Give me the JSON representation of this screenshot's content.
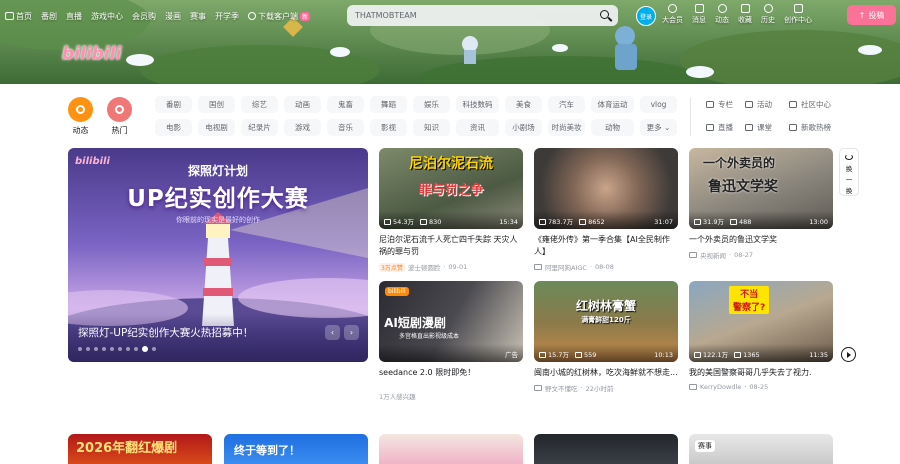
{
  "topnav": {
    "left": [
      "首页",
      "番剧",
      "直播",
      "游戏中心",
      "会员购",
      "漫画",
      "赛事",
      "开学季"
    ],
    "download": "下载客户端",
    "new_badge": "新"
  },
  "search": {
    "value": "THATMOBTEAM"
  },
  "login": "登录",
  "rightnav": [
    "大会员",
    "消息",
    "动态",
    "收藏",
    "历史",
    "创作中心"
  ],
  "upload": "投稿",
  "logo": "bilibili",
  "channels": {
    "big": [
      {
        "label": "动态",
        "color": "#ff9212"
      },
      {
        "label": "热门",
        "color": "#f07775"
      }
    ],
    "row1": [
      "番剧",
      "国创",
      "综艺",
      "动画",
      "鬼畜",
      "舞蹈",
      "娱乐",
      "科技数码",
      "美食",
      "汽车",
      "体育运动",
      "vlog"
    ],
    "row2": [
      "电影",
      "电视剧",
      "纪录片",
      "游戏",
      "音乐",
      "影视",
      "知识",
      "资讯",
      "小剧场",
      "时尚美妆",
      "动物",
      "更多"
    ],
    "side": [
      "专栏",
      "活动",
      "社区中心",
      "直播",
      "课堂",
      "新歌热榜"
    ]
  },
  "carousel": {
    "mini_logo": "bilibili",
    "headline": "探照灯计划",
    "title": "UP纪实创作大赛",
    "subtitle": "你眼前的现实是最好的创作",
    "caption": "探照灯-UP纪实创作大赛火热招募中！",
    "prev": "‹",
    "next": "›"
  },
  "cards": [
    {
      "thumb_text_1": "尼泊尔泥石流",
      "thumb_text_2": "罪与罚之争",
      "views": "54.3万",
      "danmaku": "830",
      "duration": "15:34",
      "title": "尼泊尔泥石流千人死亡四千失踪 天灾人祸的罪与罚",
      "badge": "3万点赞",
      "author": "波士顿圆脸",
      "date": "09-01"
    },
    {
      "thumb_text_1": "",
      "thumb_text_2": "",
      "views": "783.7万",
      "danmaku": "8652",
      "duration": "31:07",
      "title": "《雍佬外传》第一季合集【AI全民制作人】",
      "badge": "",
      "author": "阿里阿狗AIGC",
      "date": "08-08"
    },
    {
      "thumb_text_1": "一个外卖员的",
      "thumb_text_2": "鲁迅文学奖",
      "views": "31.9万",
      "danmaku": "488",
      "duration": "13:00",
      "title": "一个外卖员的鲁迅文学奖",
      "badge": "",
      "author": "央视新闻",
      "date": "08-27"
    },
    {
      "thumb_text_1": "AI短剧漫剧",
      "thumb_text_2": "多宫格直出影视级成本",
      "views": "",
      "danmaku": "",
      "duration": "广告",
      "title": "seedance 2.0 限时即免！",
      "badge": "",
      "author": "1万人感兴趣",
      "date": ""
    },
    {
      "thumb_text_1": "红树林膏蟹",
      "thumb_text_2": "满膏鲜甜120斤",
      "views": "15.7万",
      "danmaku": "559",
      "duration": "10:13",
      "title": "闽南小城的红树林，吃次海鲜就不想走...",
      "badge": "",
      "author": "野文不懂吃",
      "date": "22小时前"
    },
    {
      "thumb_text_1": "不当",
      "thumb_text_2": "警察了?",
      "views": "122.1万",
      "danmaku": "1365",
      "duration": "11:35",
      "title": "我的美国警察哥哥几乎失去了视力.",
      "badge": "",
      "author": "KerryDowdle",
      "date": "08-25"
    }
  ],
  "refresh": {
    "label1": "换",
    "label2": "一",
    "label3": "换"
  },
  "bottom": {
    "b1": "2026年翻红爆剧",
    "b2": "终于等到了！",
    "b5": "赛事"
  }
}
